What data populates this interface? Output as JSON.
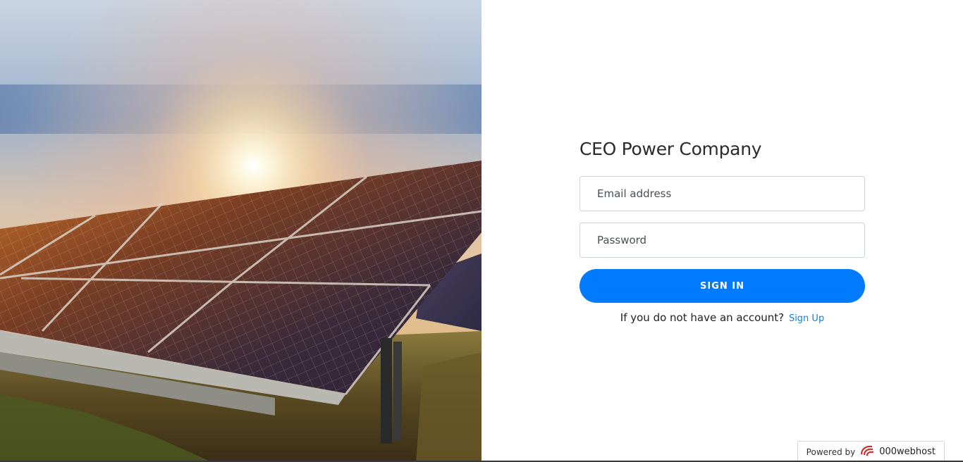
{
  "hero": {
    "image": "solar-panels-photo"
  },
  "login": {
    "title": "CEO Power Company",
    "email_placeholder": "Email address",
    "password_placeholder": "Password",
    "signin_label": "SIGN IN",
    "signup_prompt": "If you do not have an account?",
    "signup_link": "Sign Up"
  },
  "footer": {
    "powered_label": "Powered by",
    "brand": "000webhost",
    "brand_icon": "000webhost-logo-icon"
  },
  "colors": {
    "primary": "#007bff",
    "link": "#1a7fd4"
  }
}
